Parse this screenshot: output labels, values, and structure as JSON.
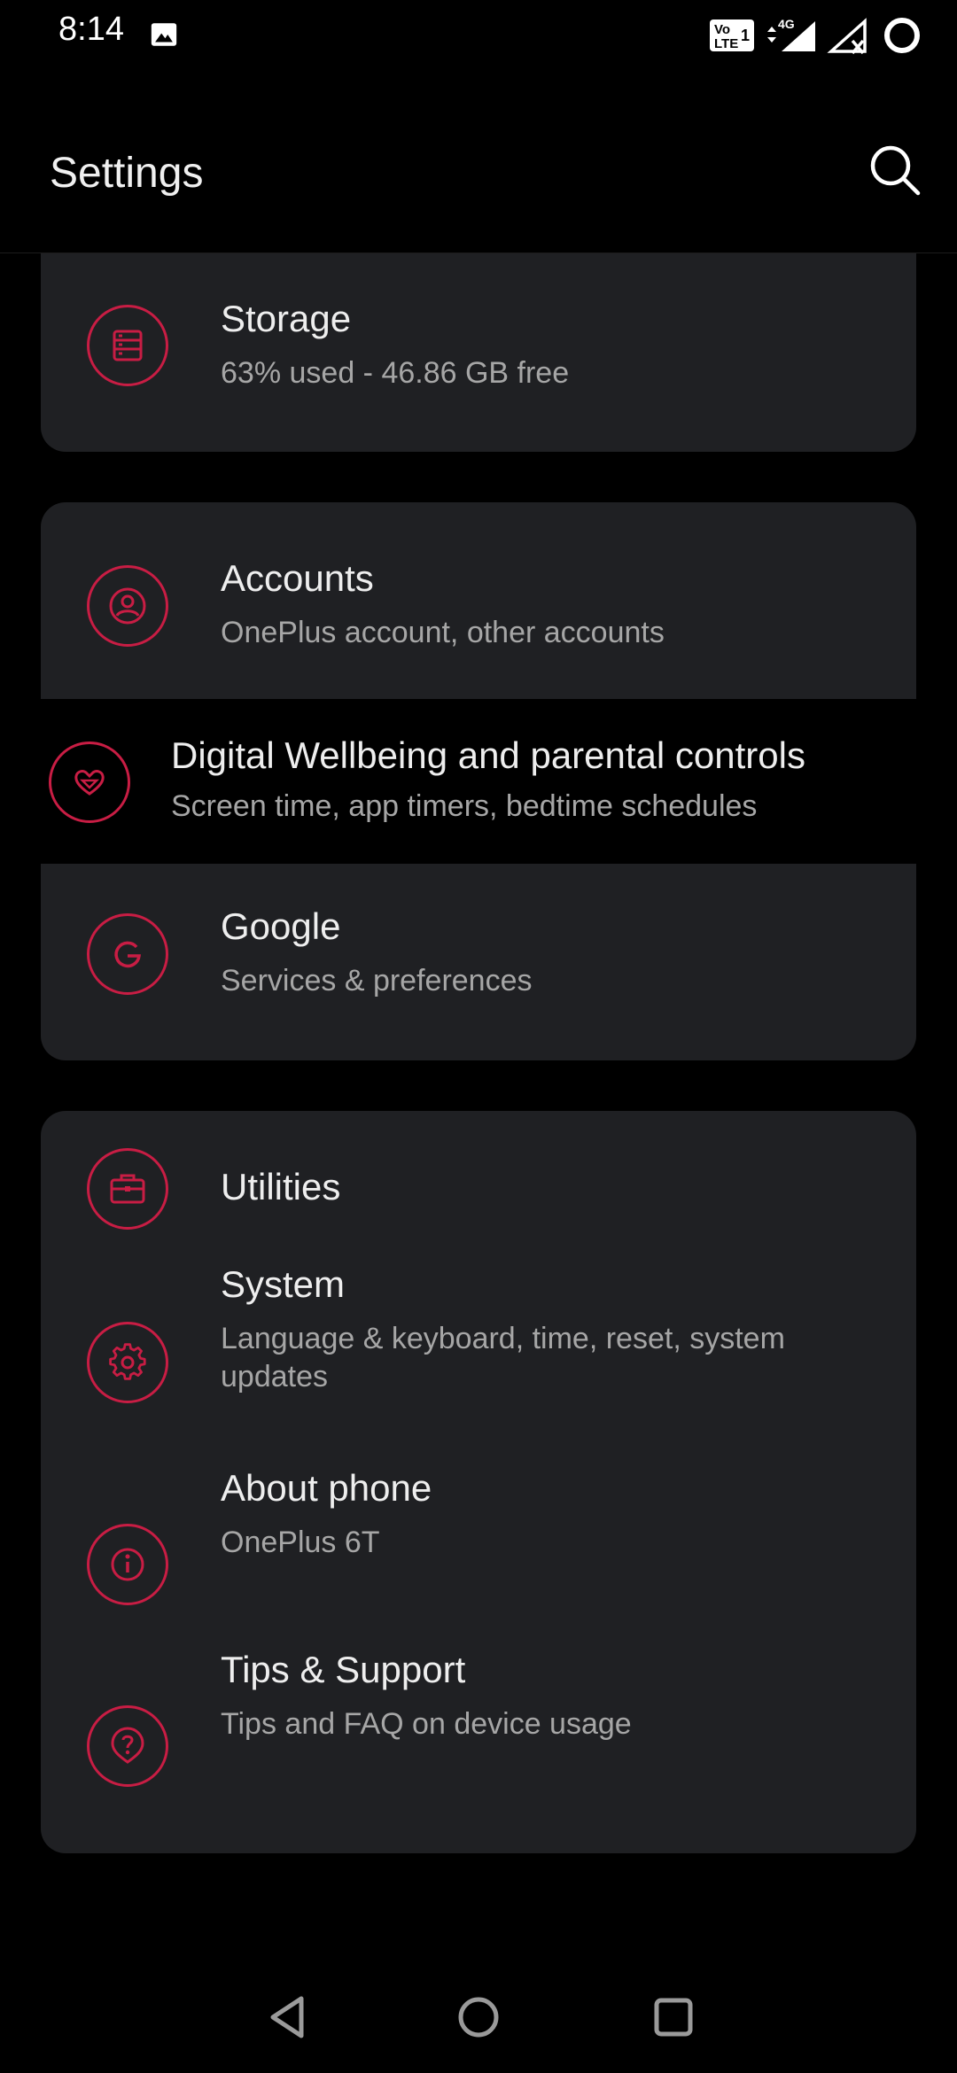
{
  "status_bar": {
    "time": "8:14",
    "icons": [
      "gallery-icon",
      "volte-icon",
      "4g-signal-icon",
      "no-signal-icon",
      "battery-ring-icon"
    ],
    "volte_label": "Vo LTE 1",
    "network_label": "4G"
  },
  "header": {
    "title": "Settings",
    "search_icon": "search-icon"
  },
  "accent_color": "#c81d44",
  "items": {
    "storage": {
      "title": "Storage",
      "subtitle": "63% used - 46.86 GB free",
      "icon": "storage-icon"
    },
    "accounts": {
      "title": "Accounts",
      "subtitle": "OnePlus account, other accounts",
      "icon": "account-icon"
    },
    "wellbeing": {
      "title": "Digital Wellbeing and parental controls",
      "subtitle": "Screen time, app timers, bedtime schedules",
      "icon": "heart-icon"
    },
    "google": {
      "title": "Google",
      "subtitle": "Services & preferences",
      "icon": "google-icon"
    },
    "utilities": {
      "title": "Utilities",
      "icon": "briefcase-icon"
    },
    "system": {
      "title": "System",
      "subtitle": "Language & keyboard, time, reset, system updates",
      "icon": "gear-icon"
    },
    "about": {
      "title": "About phone",
      "subtitle": "OnePlus 6T",
      "icon": "info-icon"
    },
    "tips": {
      "title": "Tips & Support",
      "subtitle": "Tips and FAQ on device usage",
      "icon": "help-icon"
    }
  },
  "nav_bar": {
    "buttons": [
      "back-icon",
      "home-icon",
      "recents-icon"
    ]
  }
}
